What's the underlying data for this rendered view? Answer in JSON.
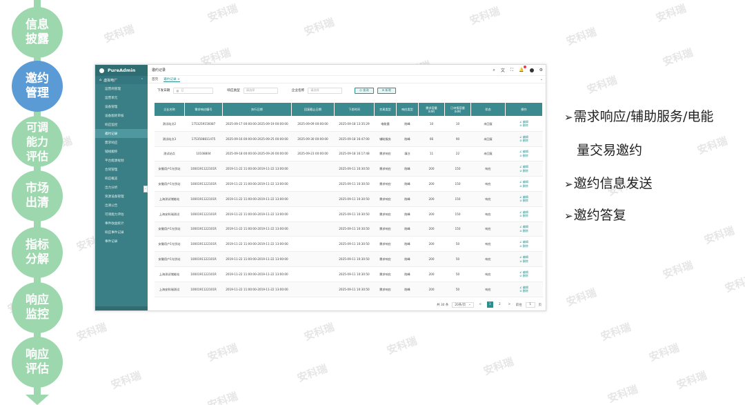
{
  "watermark": "安科瑞",
  "steps": [
    {
      "label": "信息\n披露",
      "active": false
    },
    {
      "label": "邀约\n管理",
      "active": true
    },
    {
      "label": "可调\n能力\n评估",
      "active": false
    },
    {
      "label": "市场\n出清",
      "active": false
    },
    {
      "label": "指标\n分解",
      "active": false
    },
    {
      "label": "响应\n监控",
      "active": false
    },
    {
      "label": "响应\n评估",
      "active": false
    }
  ],
  "app": {
    "brand": "PureAdmin",
    "menu_group": "虚拟电厂",
    "menu": [
      "运营商管理",
      "运营单元",
      "设备管理",
      "设备能耗审核",
      "响应监控",
      "邀约记录",
      "需求响应",
      "辅线搬移",
      "平台能源规划",
      "合同管理",
      "响应概览",
      "出力分析",
      "资源设备管理",
      "出清公告",
      "可调能力评估",
      "事件收益统计",
      "响应事件记录",
      "事件记录"
    ],
    "active_menu": 5,
    "page_title": "邀约记录",
    "tabs": [
      "首页",
      "邀约记录 ×"
    ],
    "filters": {
      "date_label": "下发日期",
      "date_placeholder": "日",
      "type_label": "响应类型",
      "type_placeholder": "请选择",
      "company_label": "企业名称",
      "company_placeholder": "请选择",
      "search_btn": "◎ 查询",
      "add_btn": "⊕ 新增"
    },
    "columns": [
      "企业名称",
      "需求响应编号",
      "执行日期",
      "回复截止日期",
      "下发时间",
      "交易类型",
      "响应类型",
      "需求容量\n(kW)",
      "已申报容量\n(kW)",
      "状态",
      "操作"
    ],
    "rows": [
      [
        "测试站点2",
        "1753259156087",
        "2025-09-17 00:00:00-2025-09-19 00:00:00",
        "2025-09-09 00:00:00",
        "2025-09-18 13:35:29",
        "电能量",
        "削峰",
        "10",
        "10",
        "未回复"
      ],
      [
        "测试站点3",
        "1753508811475",
        "2025-09-16 00:00:00-2025-09-25 00:00:00",
        "2025-09-30 00:00:00",
        "2025-09-18 16:47:00",
        "辅助服务",
        "削峰",
        "66",
        "90",
        "未回复"
      ],
      [
        "测试站点",
        "10108804",
        "2025-09-18 00:00:00-2025-09-26 00:00:00",
        "2025-09-23 00:00:00",
        "2025-09-18 16:17:48",
        "需求响应",
        "填谷",
        "11",
        "22",
        "未回复"
      ],
      [
        "安徽用户1光伏站",
        "1000191122101R",
        "2019-11-22 11:00:00-2019-11-22 13:00:00",
        "",
        "2025-09-11 10:30:50",
        "需求响应",
        "削峰",
        "200",
        "150",
        "响应"
      ],
      [
        "安徽用户1光伏站",
        "1000191122101R",
        "2019-11-22 11:00:00-2019-11-22 13:00:00",
        "",
        "2025-09-11 10:30:50",
        "需求响应",
        "削峰",
        "200",
        "150",
        "响应"
      ],
      [
        "上海测试储能站",
        "1000191122101R",
        "2019-11-22 11:00:00-2019-11-22 13:00:00",
        "",
        "2025-09-11 10:30:50",
        "需求响应",
        "削峰",
        "200",
        "150",
        "响应"
      ],
      [
        "上海安科瑞测试",
        "1000191122101R",
        "2019-11-22 11:00:00-2019-11-22 13:00:00",
        "",
        "2025-09-11 10:30:50",
        "需求响应",
        "削峰",
        "200",
        "150",
        "响应"
      ],
      [
        "安徽用户1光伏站",
        "1000191122101R",
        "2019-11-22 11:00:00-2019-11-22 13:00:00",
        "",
        "2025-09-11 10:30:50",
        "需求响应",
        "削峰",
        "200",
        "150",
        "响应"
      ],
      [
        "安徽用户1光伏站",
        "1000191122101R",
        "2019-11-22 11:00:00-2019-11-22 13:00:00",
        "",
        "2025-09-11 10:30:50",
        "需求响应",
        "削峰",
        "200",
        "50",
        "响应"
      ],
      [
        "安徽用户1光伏站",
        "1000191122101R",
        "2019-11-22 11:00:00-2019-11-22 13:00:00",
        "",
        "2025-09-11 10:30:50",
        "需求响应",
        "削峰",
        "200",
        "50",
        "响应"
      ],
      [
        "上海测试储能站",
        "1000191122101R",
        "2019-11-22 11:00:00-2019-11-22 13:00:00",
        "",
        "2025-09-11 10:30:50",
        "需求响应",
        "削峰",
        "200",
        "50",
        "响应"
      ],
      [
        "上海安科瑞测试",
        "1000191122101R",
        "2019-11-22 11:00:00-2019-11-22 13:00:00",
        "",
        "2025-09-11 10:30:50",
        "需求响应",
        "削峰",
        "200",
        "50",
        "响应"
      ]
    ],
    "op_edit": "∠ 编辑",
    "op_delete": "⊘ 删除",
    "pager": {
      "total": "共 30 条",
      "page_size": "20条/页",
      "prev": "<",
      "pages": [
        "1",
        "2"
      ],
      "next": ">",
      "goto_label": "前往",
      "goto_value": "1",
      "goto_unit": "页"
    }
  },
  "bullets": [
    "需求响应/辅助服务/电能",
    "量交易邀约",
    "邀约信息发送",
    "邀约答复"
  ],
  "bullet_marks": [
    true,
    false,
    true,
    true
  ],
  "colors": {
    "step": "#9dd7ad",
    "step_active": "#5b9bd5",
    "sidebar": "#3a7f86",
    "accent": "#2a8f8f"
  }
}
